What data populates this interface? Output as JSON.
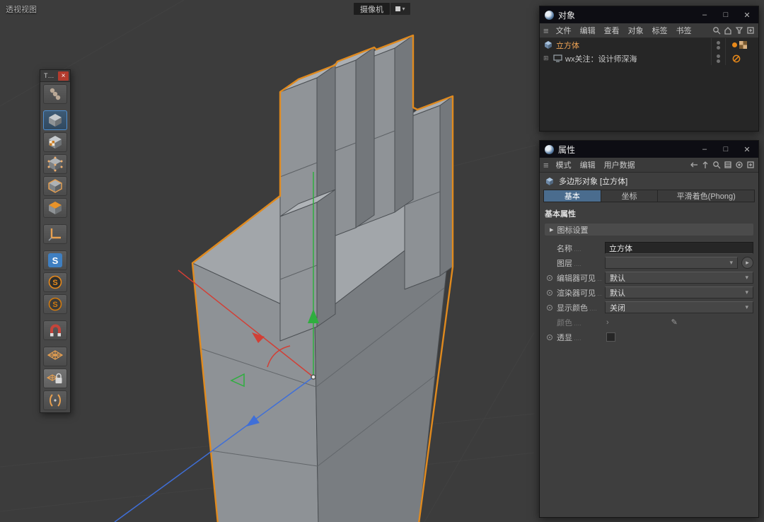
{
  "viewport": {
    "label": "透视视图",
    "camera_label": "摄像机"
  },
  "glyphs": {
    "dropdown_arrow": "▾",
    "group_arrow": "▸",
    "hamburger": "≡",
    "expander": "⊞",
    "minimize": "–",
    "maximize": "□",
    "close": "✕",
    "palette_title": "T…",
    "palette_close": "×",
    "color_chevron": "›",
    "pencil": "✎",
    "camera_arrow": "▾"
  },
  "colors": {
    "selection_outline": "#e08a1e",
    "accent_orange": "#e8891a",
    "axis_x": "#d23f35",
    "axis_y": "#2fae3f",
    "axis_z": "#3f6fd8",
    "active_tab": "#4a6c8e",
    "viewport_bg": "#3c3c3c"
  },
  "left_palette": {
    "icons": [
      "joints-tool",
      "model-mode",
      "texture-mode",
      "points-mode",
      "edges-mode",
      "polygons-mode",
      "axis-mode",
      "snap-s-blue",
      "snap-s-orange-1",
      "snap-s-orange-2",
      "magnet-tool",
      "workplane-grid",
      "workplane-lock",
      "expression-tool"
    ]
  },
  "objects_panel": {
    "title": "对象",
    "menu_items": [
      "文件",
      "编辑",
      "查看",
      "对象",
      "标签",
      "书签"
    ],
    "objects": [
      {
        "name": "立方体",
        "selected": true
      },
      {
        "name": "wx关注：设计师深海",
        "selected": false
      }
    ]
  },
  "attributes_panel": {
    "title": "属性",
    "menu_items": [
      "模式",
      "编辑",
      "用户数据"
    ],
    "object_type": "多边形对象 [立方体]",
    "tabs": [
      "基本",
      "坐标",
      "平滑着色(Phong)"
    ],
    "active_tab": "基本",
    "section_title": "基本属性",
    "icon_settings": "图标设置",
    "fields": {
      "name_label": "名称",
      "name_value": "立方体",
      "layer_label": "图层",
      "layer_value": "",
      "editor_label": "编辑器可见",
      "editor_value": "默认",
      "renderer_label": "渲染器可见",
      "renderer_value": "默认",
      "display_color_label": "显示颜色",
      "display_color_value": "关闭",
      "color_label": "颜色",
      "xray_label": "透显",
      "xray_checked": false
    }
  }
}
